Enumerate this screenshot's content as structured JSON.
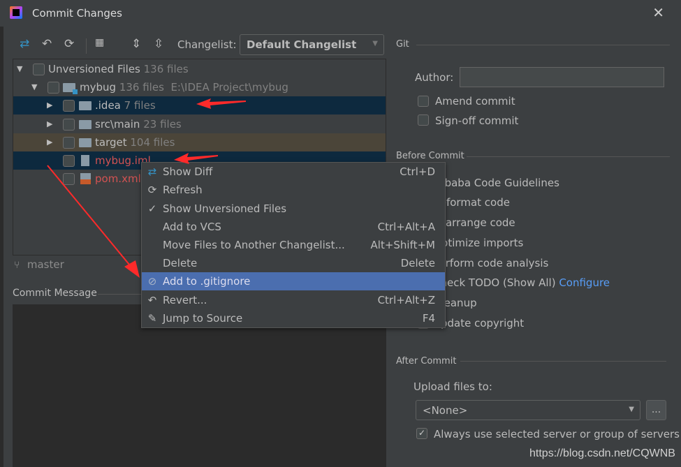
{
  "window": {
    "title": "Commit Changes"
  },
  "toolbar": {
    "changelist_label": "Changelist:",
    "changelist_value": "Default Changelist"
  },
  "tree": {
    "root": {
      "label": "Unversioned Files",
      "count": "136 files"
    },
    "project": {
      "label": "mybug",
      "count": "136 files",
      "path": "E:\\IDEA Project\\mybug"
    },
    "items": [
      {
        "label": ".idea",
        "count": "7 files"
      },
      {
        "label": "src\\main",
        "count": "23 files"
      },
      {
        "label": "target",
        "count": "104 files"
      },
      {
        "label": "mybug.iml",
        "count": ""
      },
      {
        "label": "pom.xml",
        "count": ""
      }
    ]
  },
  "branch": "master",
  "commit_message": {
    "label": "Commit Message",
    "value": ""
  },
  "context_menu": [
    {
      "label": "Show Diff",
      "shortcut": "Ctrl+D",
      "icon": "diff-icon"
    },
    {
      "label": "Refresh",
      "shortcut": "",
      "icon": "refresh-icon"
    },
    {
      "label": "Show Unversioned Files",
      "shortcut": "",
      "icon": "check-icon"
    },
    {
      "label": "Add to VCS",
      "shortcut": "Ctrl+Alt+A",
      "icon": ""
    },
    {
      "label": "Move Files to Another Changelist...",
      "shortcut": "Alt+Shift+M",
      "icon": ""
    },
    {
      "label": "Delete",
      "shortcut": "Delete",
      "icon": ""
    },
    {
      "label": "Add to .gitignore",
      "shortcut": "",
      "icon": "gitignore-icon"
    },
    {
      "label": "Revert...",
      "shortcut": "Ctrl+Alt+Z",
      "icon": "revert-icon"
    },
    {
      "label": "Jump to Source",
      "shortcut": "F4",
      "icon": "edit-icon"
    }
  ],
  "git": {
    "section": "Git",
    "author_label": "Author:",
    "author_value": "",
    "amend": "Amend commit",
    "signoff": "Sign-off commit"
  },
  "before_commit": {
    "section": "Before Commit",
    "items": [
      "Alibaba Code Guidelines",
      "Reformat code",
      "Rearrange code",
      "Optimize imports",
      "Perform code analysis",
      "Check TODO (Show All)",
      "Cleanup",
      "Update copyright"
    ],
    "configure_link": "Configure"
  },
  "after_commit": {
    "section": "After Commit",
    "upload_label": "Upload files to:",
    "upload_value": "<None>",
    "browse": "...",
    "always_use": "Always use selected server or group of servers",
    "always_use_checked": true
  },
  "watermark": "https://blog.csdn.net/CQWNB",
  "colors": {
    "selection": "#0d293e",
    "menu_highlight": "#4b6eaf",
    "link": "#589df6",
    "unversioned": "#d25252",
    "annotation": "#ff2a2a"
  }
}
